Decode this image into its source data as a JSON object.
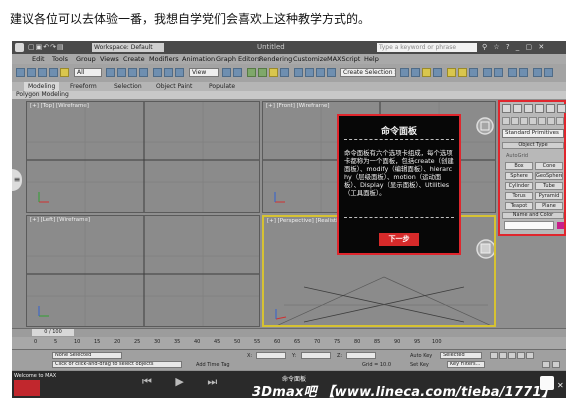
{
  "caption": "建议各位可以去体验一番，我想自学党们会喜欢上这种教学方式的。",
  "titlebar": {
    "workspace": "Workspace: Default",
    "title": "Untitled",
    "search_placeholder": "Type a keyword or phrase"
  },
  "menu": {
    "items": [
      "Edit",
      "Tools",
      "Group",
      "Views",
      "Create",
      "Modifiers",
      "Animation",
      "Graph Editors",
      "Rendering",
      "Customize",
      "MAXScript",
      "Help"
    ]
  },
  "toolbar": {
    "filter_value": "All",
    "view_value": "View",
    "selection_set_placeholder": "Create Selection Set"
  },
  "ribbon": {
    "tabs": [
      "Modeling",
      "Freeform",
      "Selection",
      "Object Paint",
      "Populate"
    ],
    "sub_label": "Polygon Modeling"
  },
  "viewports": {
    "top": "[+] [Top] [Wireframe]",
    "front": "[+] [Front] [Wireframe]",
    "left": "[+] [Left] [Wireframe]",
    "perspective": "[+] [Perspective] [Realistic]"
  },
  "command_panel": {
    "dropdown": "Standard Primitives",
    "object_type": "Object Type",
    "autogrid": "AutoGrid",
    "buttons": [
      "Box",
      "Cone",
      "Sphere",
      "GeoSphere",
      "Cylinder",
      "Tube",
      "Torus",
      "Pyramid",
      "Teapot",
      "Plane"
    ],
    "name_and_color": "Name and Color"
  },
  "overlay": {
    "title": "命令面板",
    "body": "命令面板有六个选项卡组成，每个选项卡都称为一个面板，包括create（创建面板）、modify（编辑面板）、hierarchy（层级面板）、motion（运动面板）、Display（显示面板）、Utilities（工具面板）。",
    "next_button": "下一步"
  },
  "timeline": {
    "frame": "0 / 100",
    "ticks": [
      "0",
      "5",
      "10",
      "15",
      "20",
      "25",
      "30",
      "35",
      "40",
      "45",
      "50",
      "55",
      "60",
      "65",
      "70",
      "75",
      "80",
      "85",
      "90",
      "95",
      "100"
    ]
  },
  "status": {
    "selection": "None Selected",
    "prompt": "Click or click-and-drag to select objects",
    "x_label": "X:",
    "y_label": "Y:",
    "z_label": "Z:",
    "grid": "Grid = 10.0",
    "auto_key": "Auto Key",
    "selected": "Selected",
    "set_key": "Set Key",
    "key_filters": "Key Filters...",
    "add_time_tag": "Add Time Tag"
  },
  "bottom": {
    "welcome": "Welcome to MAX",
    "command_tag": "命令面板",
    "watermark": "3Dmax吧 【www.lineca.com/tieba/1771】"
  },
  "colors": {
    "highlight_border": "#e0262d",
    "next_button": "#d62a2a",
    "active_viewport": "#d6c232"
  }
}
